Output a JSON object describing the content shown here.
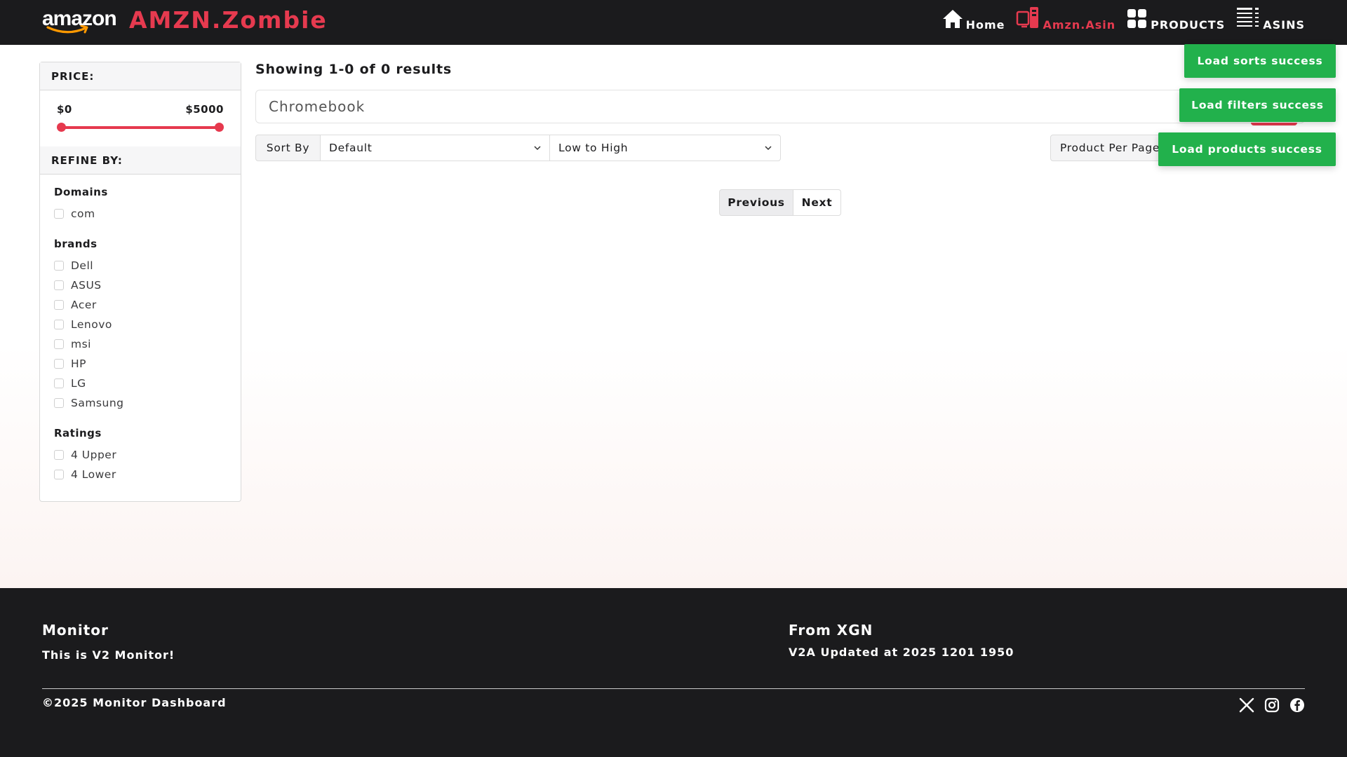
{
  "header": {
    "logo_text": "amazon",
    "brand_title": "AMZN.Zombie",
    "nav": [
      {
        "label": "Home",
        "icon": "home-icon",
        "active": false
      },
      {
        "label": "Amzn.Asin",
        "icon": "devices-icon",
        "active": true
      },
      {
        "label": "PRODUCTS",
        "icon": "grid-icon",
        "active": false
      },
      {
        "label": "ASINS",
        "icon": "list-icon",
        "active": false
      }
    ]
  },
  "sidebar": {
    "price_heading": "PRICE:",
    "price_min": "$0",
    "price_max": "$5000",
    "refine_heading": "REFINE BY:",
    "groups": {
      "domains": {
        "title": "Domains",
        "options": [
          "com"
        ]
      },
      "brands": {
        "title": "brands",
        "options": [
          "Dell",
          "ASUS",
          "Acer",
          "Lenovo",
          "msi",
          "HP",
          "LG",
          "Samsung"
        ]
      },
      "ratings": {
        "title": "Ratings",
        "options": [
          "4 Upper",
          "4 Lower"
        ]
      }
    }
  },
  "main": {
    "results_text": "Showing 1-0 of 0 results",
    "search_value": "Chromebook",
    "sort_label": "Sort By",
    "sort_value": "Default",
    "order_value": "Low to High",
    "per_page_label": "Product Per Page",
    "prev_label": "Previous",
    "next_label": "Next"
  },
  "toasts": [
    "Load sorts success",
    "Load filters success",
    "Load products success"
  ],
  "footer": {
    "col1_title": "Monitor",
    "col1_text": "This is V2 Monitor!",
    "col2_title": "From XGN",
    "col2_text": "V2A Updated at 2025 1201 1950",
    "copyright": "©2025 Monitor Dashboard",
    "socials": [
      "x-icon",
      "instagram-icon",
      "facebook-icon"
    ]
  },
  "colors": {
    "accent": "#e63a4f",
    "header_bg": "#1b1b1d",
    "toast_bg": "#22b14c"
  }
}
